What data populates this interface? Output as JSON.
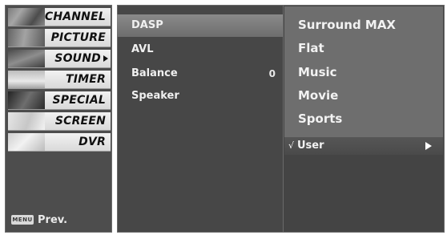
{
  "main_menu": {
    "items": [
      {
        "label": "CHANNEL",
        "icon": "channel-thumbnail-icon"
      },
      {
        "label": "PICTURE",
        "icon": "picture-thumbnail-icon"
      },
      {
        "label": "SOUND",
        "icon": "sound-thumbnail-icon",
        "selected": true
      },
      {
        "label": "TIMER",
        "icon": "timer-thumbnail-icon"
      },
      {
        "label": "SPECIAL",
        "icon": "special-thumbnail-icon"
      },
      {
        "label": "SCREEN",
        "icon": "screen-thumbnail-icon"
      },
      {
        "label": "DVR",
        "icon": "dvr-thumbnail-icon"
      }
    ],
    "footer": {
      "key_label": "MENU",
      "action_label": "Prev."
    }
  },
  "sound_menu": {
    "items": [
      {
        "label": "DASP",
        "value": "",
        "selected": true
      },
      {
        "label": "AVL",
        "value": ""
      },
      {
        "label": "Balance",
        "value": "0"
      },
      {
        "label": "Speaker",
        "value": ""
      }
    ]
  },
  "dasp_options": {
    "items": [
      {
        "label": "Surround MAX"
      },
      {
        "label": "Flat"
      },
      {
        "label": "Music"
      },
      {
        "label": "Movie"
      },
      {
        "label": "Sports"
      }
    ],
    "current": {
      "check_mark": "√",
      "label": "User",
      "icon": "play-arrow-icon"
    }
  },
  "colors": {
    "panel_dark": "#474747",
    "panel_mid": "#6e6e6e",
    "menu_item_light": "#e6e6e6",
    "text_light": "#f0f0f0",
    "text_dark": "#111111"
  }
}
